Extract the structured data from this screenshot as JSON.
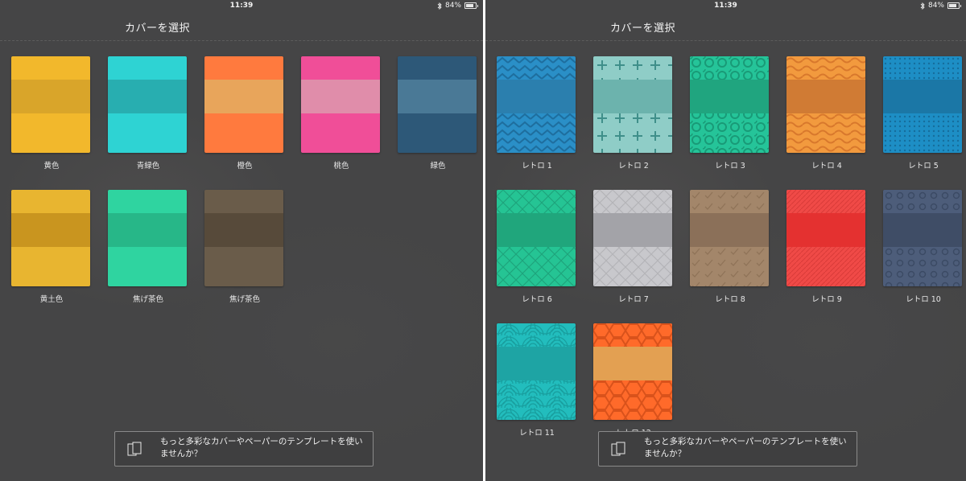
{
  "status_bar": {
    "time": "11:39",
    "battery": "84%",
    "battery_level": 0.84
  },
  "screen_title": "カバーを選択",
  "promo_text": "もっと多彩なカバーやペーパーのテンプレートを使いませんか？",
  "left_covers": [
    {
      "label": "黄色",
      "body": "#f2b82c",
      "band": "#d9a52a"
    },
    {
      "label": "青緑色",
      "body": "#2ed3d3",
      "band": "#28aeb0"
    },
    {
      "label": "橙色",
      "body": "#ff7a3e",
      "band": "#e8a55b"
    },
    {
      "label": "桃色",
      "body": "#f04e98",
      "band": "#e08daa"
    },
    {
      "label": "緑色",
      "body": "#2d5878",
      "band": "#4a7996"
    },
    {
      "label": "黄土色",
      "body": "#e8b530",
      "band": "#c9951f"
    },
    {
      "label": "焦げ茶色",
      "body": "#2fd4a0",
      "band": "#27b788"
    },
    {
      "label": "焦げ茶色",
      "body": "#6a5c4a",
      "band": "#574a3a"
    }
  ],
  "right_covers": [
    {
      "label": "レトロ 1",
      "body": "#2a8fc7",
      "band": "#2b7fae",
      "pattern": "zigzag",
      "pattern_color": "#1e6e9e"
    },
    {
      "label": "レトロ 2",
      "body": "#8fcdc7",
      "band": "#6cb3ad",
      "pattern": "plus",
      "pattern_color": "#3f8f8a"
    },
    {
      "label": "レトロ 3",
      "body": "#25c499",
      "band": "#20a57f",
      "pattern": "circles",
      "pattern_color": "#199a77"
    },
    {
      "label": "レトロ 4",
      "body": "#f29a3e",
      "band": "#d07b34",
      "pattern": "waves",
      "pattern_color": "#d8782c"
    },
    {
      "label": "レトロ 5",
      "body": "#1d8ec5",
      "band": "#1b77a6",
      "pattern": "dots",
      "pattern_color": "#156d9c"
    },
    {
      "label": "レトロ 6",
      "body": "#25c494",
      "band": "#20a67c",
      "pattern": "diamonds",
      "pattern_color": "#1ea47c"
    },
    {
      "label": "レトロ 7",
      "body": "#c8c8cc",
      "band": "#a3a3a8",
      "pattern": "diamonds",
      "pattern_color": "#b3b3b7"
    },
    {
      "label": "レトロ 8",
      "body": "#a3866a",
      "band": "#8b7059",
      "pattern": "checks",
      "pattern_color": "#8f7358"
    },
    {
      "label": "レトロ 9",
      "body": "#f04a47",
      "band": "#e43130",
      "pattern": "diagonal",
      "pattern_color": "#d93b38"
    },
    {
      "label": "レトロ 10",
      "body": "#4d5d7a",
      "band": "#3f4d66",
      "pattern": "rings",
      "pattern_color": "#3b4a64"
    },
    {
      "label": "レトロ 11",
      "body": "#22bdbd",
      "band": "#1ea4a4",
      "pattern": "scales",
      "pattern_color": "#189e9e"
    },
    {
      "label": "レトロ 12",
      "body": "#ff6a2a",
      "band": "#e3a052",
      "pattern": "hex",
      "pattern_color": "#d9521b"
    }
  ]
}
